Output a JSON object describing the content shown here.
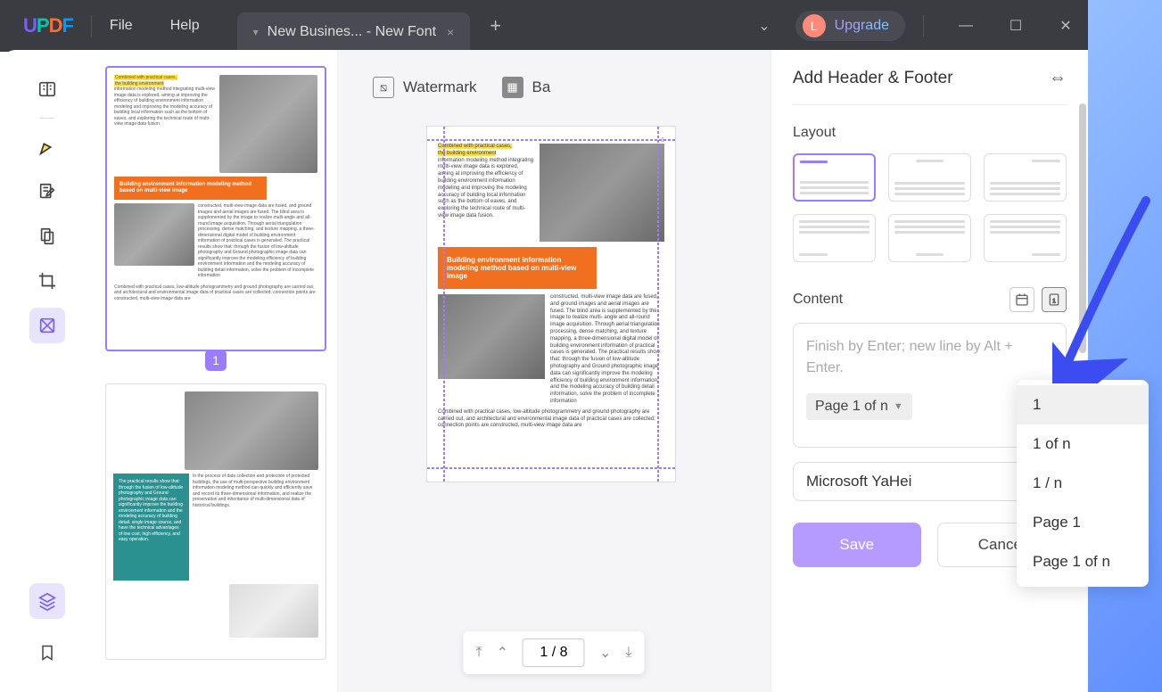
{
  "titlebar": {
    "logo": {
      "u": "U",
      "p": "P",
      "d": "D",
      "f": "F"
    },
    "menu": {
      "file": "File",
      "help": "Help"
    },
    "tab": {
      "title": "New Busines... - New Font",
      "close": "×",
      "plus": "+"
    },
    "upgrade": {
      "avatar": "L",
      "label": "Upgrade"
    },
    "window": {
      "min": "—",
      "max": "☐",
      "close": "✕"
    }
  },
  "toolbar": {
    "watermark": "Watermark",
    "background_prefix": "Ba"
  },
  "thumbnails": {
    "badge1": "1",
    "callout1": "Building environment information modeling method based on multi-view image",
    "highlight1a": "Combined with practical cases,",
    "highlight1b": "the building environment"
  },
  "preview": {
    "callout": "Building environment information modeling method based on multi-view image",
    "highlight_a": "Combined with practical cases,",
    "highlight_b": "the building environment",
    "body1": "information modeling method integrating multi-view image data is explored, aiming at improving the efficiency of building environment information modeling and improving the modeling accuracy of building local information such as the bottom of eaves, and exploring the technical route of multi- view image data fusion.",
    "body2": "constructed, multi-view image data are fused, and ground images and aerial images are fused. The blind area is supplemented by the image to realize multi- angle and all-round image acquisition. Through aerial triangulation processing, dense matching, and texture mapping, a three-dimensional digital model of building environment information of practical cases is generated. The practical results show that: through the fusion of low-altitude photography and Ground photographic image data can significantly improve the modeling efficiency of building environment information and the modeling accuracy of building detail information, solve the problem of incomplete information",
    "body3": "Combined with practical cases, low-altitude photogrammetry and ground photography are carried out, and architectural and environmental image data of practical cases are collected; connection points are constructed, multi-view image data are"
  },
  "pager": {
    "current": "1",
    "sep": "/",
    "total": "8"
  },
  "panel": {
    "title": "Add Header & Footer",
    "layout_label": "Layout",
    "content_label": "Content",
    "placeholder": "Finish by Enter; new line by Alt + Enter.",
    "tag": "Page 1 of n",
    "font": "Microsoft YaHei",
    "save": "Save",
    "cancel": "Cancel"
  },
  "dropdown": {
    "items": [
      "1",
      "1 of n",
      "1 / n",
      "Page 1",
      "Page 1 of n"
    ]
  }
}
